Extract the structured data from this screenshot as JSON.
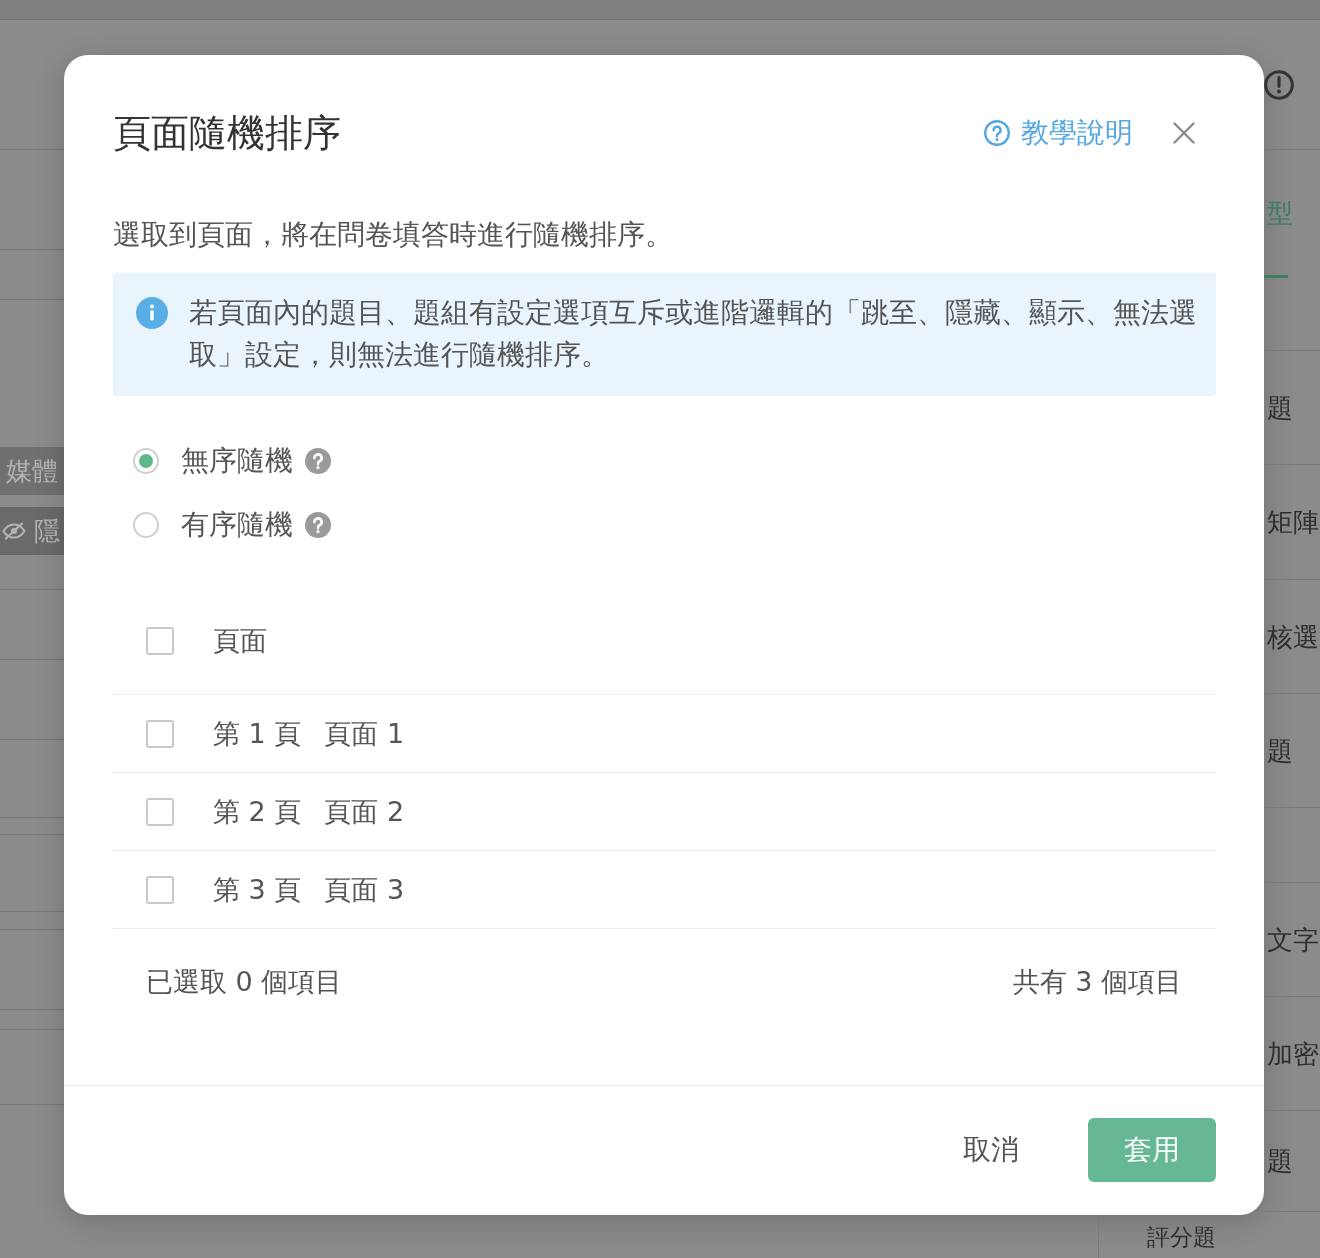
{
  "background": {
    "left_tags": [
      {
        "kind": "plain",
        "label": "媒體"
      },
      {
        "kind": "hidden",
        "label": "隱"
      }
    ],
    "right_tab": {
      "label": "型",
      "selected": true
    },
    "right_items": [
      "題",
      "矩陣",
      "核選",
      "題",
      "文字",
      "加密",
      "題"
    ],
    "bottom_item": "評分題"
  },
  "dialog": {
    "title": "頁面隨機排序",
    "help_link": "教學說明",
    "description": "選取到頁面，將在問卷填答時進行隨機排序。",
    "notice": "若頁面內的題目、題組有設定選項互斥或進階邏輯的「跳至、隱藏、顯示、無法選取」設定，則無法進行隨機排序。",
    "modes": [
      {
        "label": "無序隨機",
        "selected": true
      },
      {
        "label": "有序隨機",
        "selected": false
      }
    ],
    "header": {
      "label": "頁面",
      "checked": false
    },
    "pages": [
      {
        "number": "第 1 頁",
        "name": "頁面 1",
        "checked": false
      },
      {
        "number": "第 2 頁",
        "name": "頁面 2",
        "checked": false
      },
      {
        "number": "第 3 頁",
        "name": "頁面 3",
        "checked": false
      }
    ],
    "selected_count": "已選取 0 個項目",
    "total_count": "共有 3 個項目",
    "buttons": [
      {
        "kind": "text",
        "label": "取消"
      },
      {
        "kind": "primary",
        "label": "套用"
      }
    ]
  }
}
